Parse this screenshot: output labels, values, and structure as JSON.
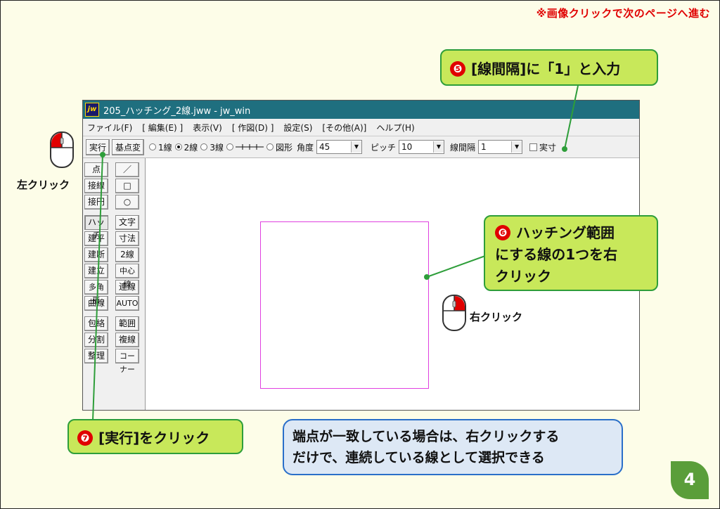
{
  "top_note": "※画像クリックで次のページへ進む",
  "callouts": {
    "step5": {
      "num": "❺",
      "text": "[線間隔]に「1」と入力"
    },
    "step6": {
      "num": "❻",
      "line1": "ハッチング範囲",
      "line2": "にする線の1つを右",
      "line3": "クリック"
    },
    "step7": {
      "num": "❼",
      "text": "[実行]をクリック"
    }
  },
  "info_box": {
    "line1": "端点が一致している場合は、右クリックする",
    "line2": "だけで、連続している線として選択できる"
  },
  "left_click_label": "左クリック",
  "right_click_label": "右クリック",
  "page_number": "4",
  "window": {
    "icon": "jw",
    "title": "205_ハッチング_2線.jww - jw_win",
    "menu": [
      "ファイル(F)",
      "[ 編集(E) ]",
      "表示(V)",
      "[ 作図(D) ]",
      "設定(S)",
      "[その他(A)]",
      "ヘルプ(H)"
    ],
    "toolbar": {
      "execute": "実行",
      "base_change": "基点変",
      "radio1": "1線",
      "radio2": "2線",
      "radio3": "3線",
      "radio_shape": "図形",
      "angle_label": "角度",
      "angle_value": "45",
      "pitch_label": "ピッチ",
      "pitch_value": "10",
      "spacing_label": "線間隔",
      "spacing_value": "1",
      "actual_label": "実寸"
    },
    "tools_col1": [
      "点",
      "接線",
      "接円",
      "ハッチ",
      "建平",
      "建断",
      "建立",
      "多角形",
      "曲線",
      "包絡",
      "分割",
      "整理"
    ],
    "tools_col2": [
      "／",
      "□",
      "○",
      "文字",
      "寸法",
      "2線",
      "中心線",
      "連線",
      "AUTO",
      "範囲",
      "複線",
      "コーナー"
    ]
  },
  "colors": {
    "accent_red": "#e00000",
    "callout_green": "#c8e85a",
    "callout_border": "#2e9e3a",
    "info_blue": "#dde8f5",
    "shape_magenta": "#e040e0",
    "title_bar": "#1f6f7f"
  }
}
